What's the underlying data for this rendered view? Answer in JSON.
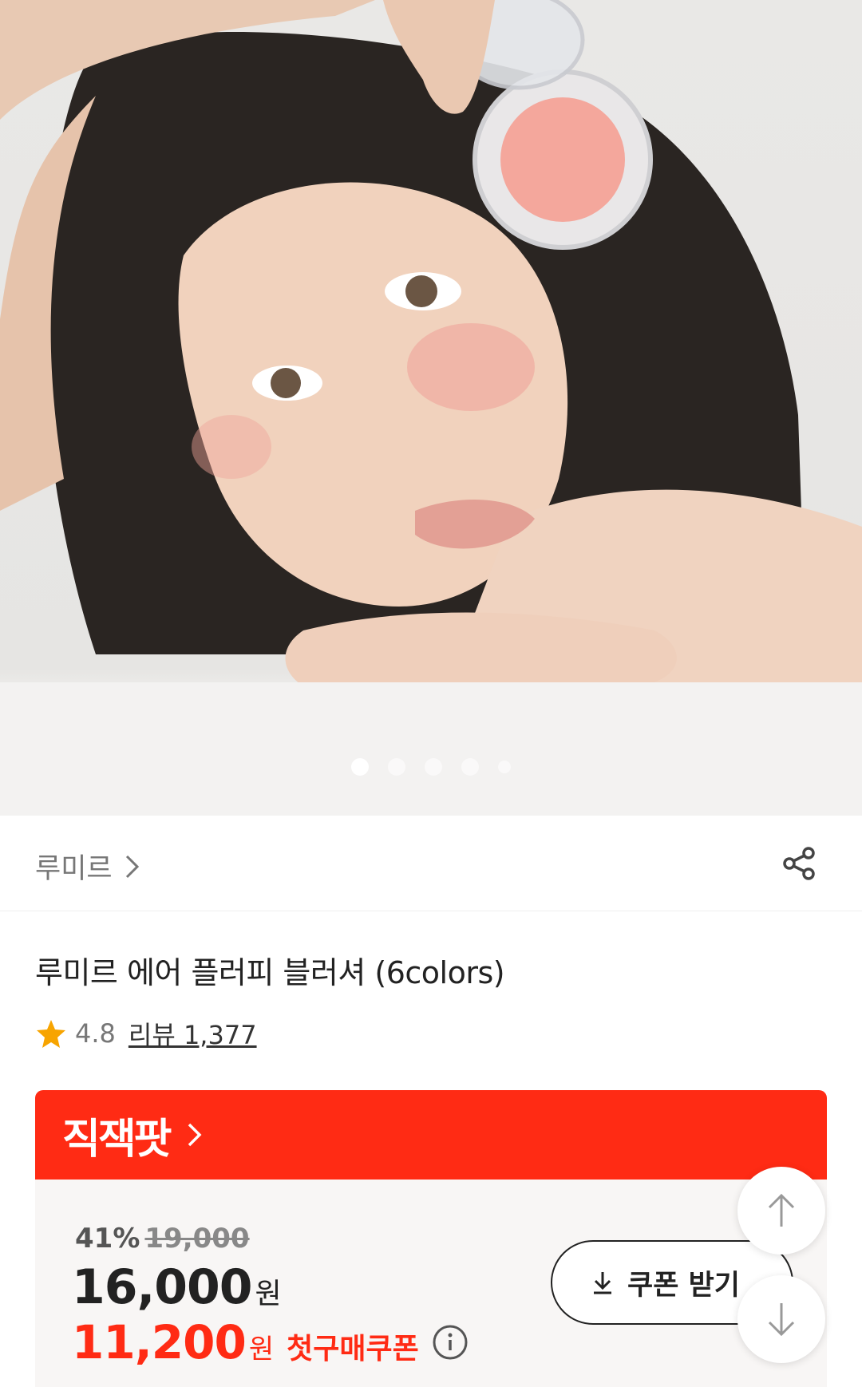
{
  "gallery": {
    "slide_count": 5,
    "active_index": 0
  },
  "brand": {
    "name": "루미르"
  },
  "product": {
    "title": "루미르 에어 플러피 블러셔 (6colors)",
    "rating": "4.8",
    "reviews_label": "리뷰 1,377"
  },
  "deal": {
    "title": "직잭팟",
    "discount_rate": "41%",
    "original_price": "19,000",
    "price": "16,000",
    "price_unit": "원",
    "coupon_price": "11,200",
    "coupon_unit": "원",
    "coupon_label": "첫구매쿠폰",
    "coupon_button": "쿠폰 받기"
  },
  "colors": {
    "accent": "#ff2b14",
    "star": "#f7a400"
  }
}
